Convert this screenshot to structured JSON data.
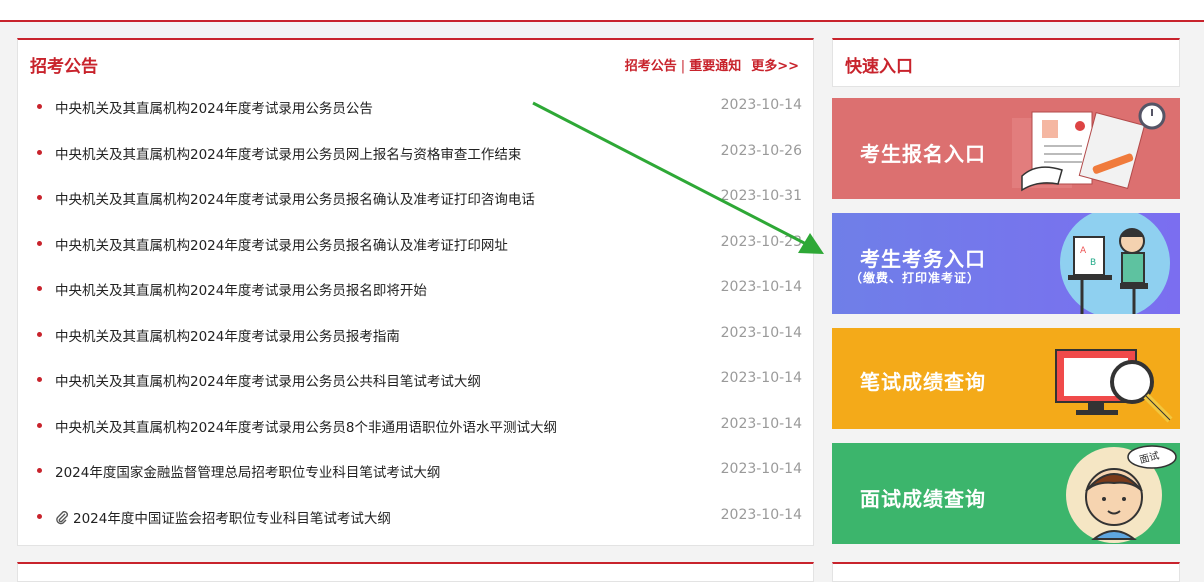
{
  "notice": {
    "title": "招考公告",
    "links": {
      "a": "招考公告",
      "sep": "|",
      "b": "重要通知",
      "more": "更多>>"
    },
    "items": [
      {
        "title": "中央机关及其直属机构2024年度考试录用公务员公告",
        "date": "2023-10-14",
        "attachment": false
      },
      {
        "title": "中央机关及其直属机构2024年度考试录用公务员网上报名与资格审查工作结束",
        "date": "2023-10-26",
        "attachment": false
      },
      {
        "title": "中央机关及其直属机构2024年度考试录用公务员报名确认及准考证打印咨询电话",
        "date": "2023-10-31",
        "attachment": false
      },
      {
        "title": "中央机关及其直属机构2024年度考试录用公务员报名确认及准考证打印网址",
        "date": "2023-10-23",
        "attachment": false
      },
      {
        "title": "中央机关及其直属机构2024年度考试录用公务员报名即将开始",
        "date": "2023-10-14",
        "attachment": false
      },
      {
        "title": "中央机关及其直属机构2024年度考试录用公务员报考指南",
        "date": "2023-10-14",
        "attachment": false
      },
      {
        "title": "中央机关及其直属机构2024年度考试录用公务员公共科目笔试考试大纲",
        "date": "2023-10-14",
        "attachment": false
      },
      {
        "title": "中央机关及其直属机构2024年度考试录用公务员8个非通用语职位外语水平测试大纲",
        "date": "2023-10-14",
        "attachment": false
      },
      {
        "title": "2024年度国家金融监督管理总局招考职位专业科目笔试考试大纲",
        "date": "2023-10-14",
        "attachment": false
      },
      {
        "title": "2024年度中国证监会招考职位专业科目笔试考试大纲",
        "date": "2023-10-14",
        "attachment": true
      }
    ]
  },
  "quick": {
    "title": "快速入口",
    "banners": [
      {
        "label": "考生报名入口",
        "icon": "application-form-icon",
        "color": "#dc7070"
      },
      {
        "label": "考生考务入口",
        "sub": "（缴费、打印准考证）",
        "icon": "student-computer-icon",
        "color": "#7478ec"
      },
      {
        "label": "笔试成绩查询",
        "icon": "monitor-magnifier-icon",
        "color": "#f4aa19"
      },
      {
        "label": "面试成绩查询",
        "icon": "interview-face-icon",
        "badge": "面试",
        "color": "#3cb56c"
      }
    ]
  },
  "colors": {
    "accent": "#c8232c",
    "date": "#9a9a9a",
    "arrow": "#2ea836"
  }
}
